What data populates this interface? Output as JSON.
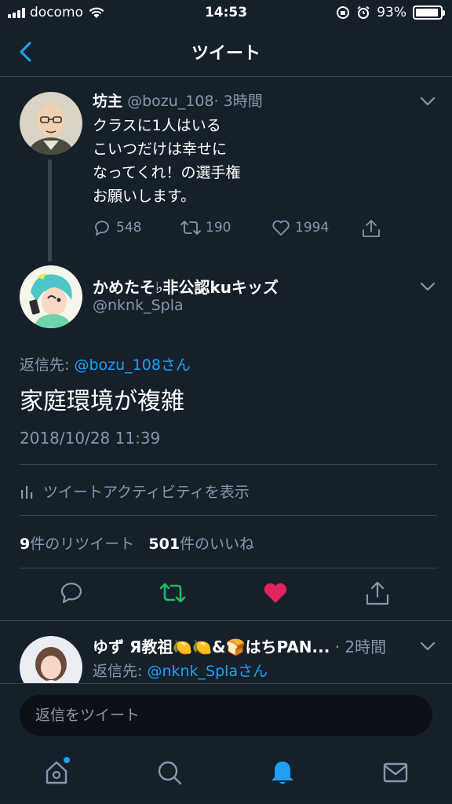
{
  "status_bar": {
    "carrier": "docomo",
    "time": "14:53",
    "battery": "93%",
    "battery_level": 0.93
  },
  "header": {
    "title": "ツイート",
    "back_icon": "chevron-left-icon"
  },
  "tweet1": {
    "name": "坊主",
    "handle": "@bozu_108",
    "time": "· 3時間",
    "lines": [
      "クラスに1人はいる",
      "こいつだけは幸せに",
      "なってくれ！の選手権",
      "お願いします。"
    ],
    "reply_count": "548",
    "retweet_count": "190",
    "like_count": "1994"
  },
  "tweet2": {
    "name": "かめたそ♭非公認kuキッズ",
    "handle": "@nknk_Spla",
    "reply_label": "返信先:",
    "reply_handle": "@bozu_108さん",
    "text": "家庭環境が複雑",
    "date": "2018/10/28 11:39",
    "activity_label": "ツイートアクティビティを表示",
    "retweets_num": "9",
    "retweets_label": "件のリツイート",
    "likes_num": "501",
    "likes_label": "件のいいね"
  },
  "tweet3": {
    "name": "ゆず Я教祖🍋🍋&🍞はちPAN...",
    "time": "· 2時間",
    "reply_label": "返信先:",
    "reply_handle": "@nknk_Splaさん"
  },
  "reply_bar": {
    "placeholder": "返信をツイート"
  },
  "colors": {
    "background": "#15202b",
    "accent": "#1da1f2",
    "retweet_green": "#17bf63",
    "like_red": "#e0245e",
    "muted": "#8899a6"
  }
}
